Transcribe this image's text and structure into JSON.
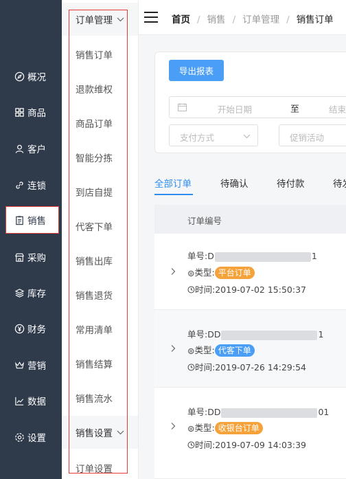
{
  "nav": {
    "items": [
      {
        "label": "概况",
        "icon": "compass-icon"
      },
      {
        "label": "商品",
        "icon": "grid-icon"
      },
      {
        "label": "客户",
        "icon": "user-icon"
      },
      {
        "label": "连锁",
        "icon": "link-icon"
      },
      {
        "label": "销售",
        "icon": "clipboard-icon"
      },
      {
        "label": "采购",
        "icon": "store-icon"
      },
      {
        "label": "库存",
        "icon": "layers-icon"
      },
      {
        "label": "财务",
        "icon": "yen-icon"
      },
      {
        "label": "营销",
        "icon": "crown-icon"
      },
      {
        "label": "数据",
        "icon": "chart-icon"
      },
      {
        "label": "设置",
        "icon": "settings-icon"
      }
    ],
    "active": "销售"
  },
  "subnav": {
    "group1": "订单管理",
    "items": [
      "销售订单",
      "退款维权",
      "商品订单",
      "智能分拣",
      "到店自提",
      "代客下单",
      "销售出库",
      "销售退货",
      "常用清单",
      "销售结算",
      "销售流水"
    ],
    "group2": "销售设置",
    "group2_items": [
      "订单设置"
    ]
  },
  "breadcrumb": {
    "home": "首页",
    "level1": "销售",
    "level2": "订单管理",
    "current": "销售订单"
  },
  "filters": {
    "export_label": "导出报表",
    "date_start_placeholder": "开始日期",
    "date_sep": "至",
    "date_end_placeholder": "结束",
    "pay_placeholder": "支付方式",
    "promo_placeholder": "促销活动"
  },
  "tabs": [
    "全部订单",
    "待确认",
    "待付款",
    "待发"
  ],
  "table": {
    "header": "订单编号",
    "rows": [
      {
        "no_prefix": "单号:D",
        "no_suffix": "1",
        "type_label": "类型:",
        "type": "平台订单",
        "type_color": "#f5a23a",
        "time_label": "时间:",
        "time": "2019-07-02 15:50:37"
      },
      {
        "no_prefix": "单号:DD",
        "no_suffix": "1",
        "type_label": "类型:",
        "type": "代客下单",
        "type_color": "#4a9ef5",
        "time_label": "时间:",
        "time": "2019-07-26 14:29:54"
      },
      {
        "no_prefix": "单号:DD",
        "no_suffix": "01",
        "type_label": "类型:",
        "type": "收银台订单",
        "type_color": "#f5a23a",
        "time_label": "时间:",
        "time": "2019-07-09 14:03:39"
      }
    ]
  }
}
